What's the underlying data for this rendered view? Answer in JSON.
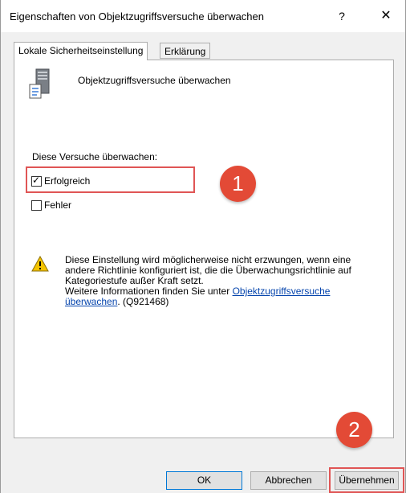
{
  "window": {
    "title": "Eigenschaften von Objektzugriffsversuche überwachen",
    "help_label": "?",
    "close_label": "✕"
  },
  "tabs": [
    {
      "label": "Lokale Sicherheitseinstellung",
      "active": true
    },
    {
      "label": "Erklärung",
      "active": false
    }
  ],
  "policy": {
    "name": "Objektzugriffsversuche überwachen",
    "icon": "server-policy-icon"
  },
  "audit": {
    "group_label": "Diese Versuche überwachen:",
    "options": [
      {
        "label": "Erfolgreich",
        "checked": true
      },
      {
        "label": "Fehler",
        "checked": false
      }
    ]
  },
  "warning": {
    "icon": "warning-icon",
    "line1": "Diese Einstellung wird möglicherweise nicht erzwungen, wenn eine",
    "line2": "andere Richtlinie konfiguriert ist, die die Überwachungsrichtlinie auf",
    "line3": "Kategoriestufe außer Kraft setzt.",
    "line4_prefix": "Weitere Informationen finden Sie unter ",
    "link_part1": "Objektzugriffsversuche",
    "link_part2": "überwachen",
    "suffix": ". (Q921468)"
  },
  "annotations": {
    "badge1": "1",
    "badge2": "2",
    "color": "#e34a36"
  },
  "buttons": {
    "ok": "OK",
    "cancel": "Abbrechen",
    "apply": "Übernehmen"
  }
}
